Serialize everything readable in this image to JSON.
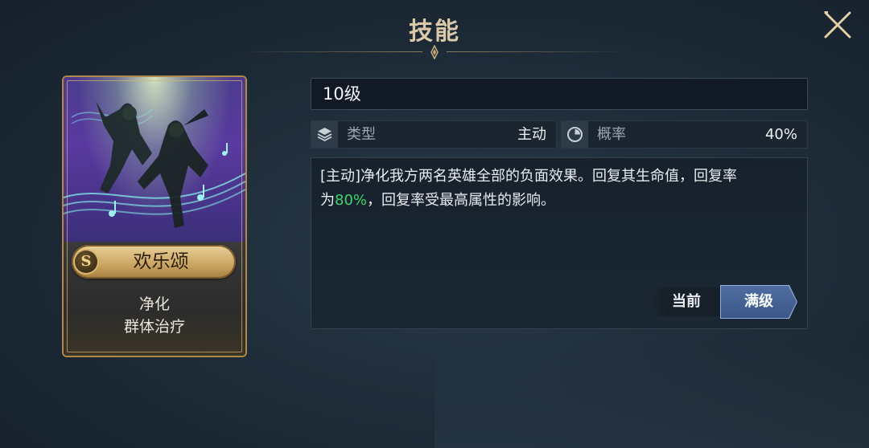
{
  "header": {
    "title": "技能"
  },
  "card": {
    "rank": "S",
    "name": "欢乐颂",
    "tags": [
      "净化",
      "群体治疗"
    ]
  },
  "level": {
    "text": "10级"
  },
  "stats": {
    "type": {
      "label": "类型",
      "value": "主动",
      "icon": "layers-icon"
    },
    "rate": {
      "label": "概率",
      "value": "40%",
      "icon": "pie-chart-icon"
    }
  },
  "description": {
    "line1": "[主动]净化我方两名英雄全部的负面效果。回复其生命值，回复率",
    "line2_prefix": "为",
    "line2_highlight": "80%",
    "line2_suffix": "，回复率受最高属性的影响。"
  },
  "buttons": {
    "current": "当前",
    "max": "满级"
  },
  "colors": {
    "highlight": "#41d66a",
    "gold": "#d9c9a8",
    "selected_tab": "#4f6da0"
  }
}
